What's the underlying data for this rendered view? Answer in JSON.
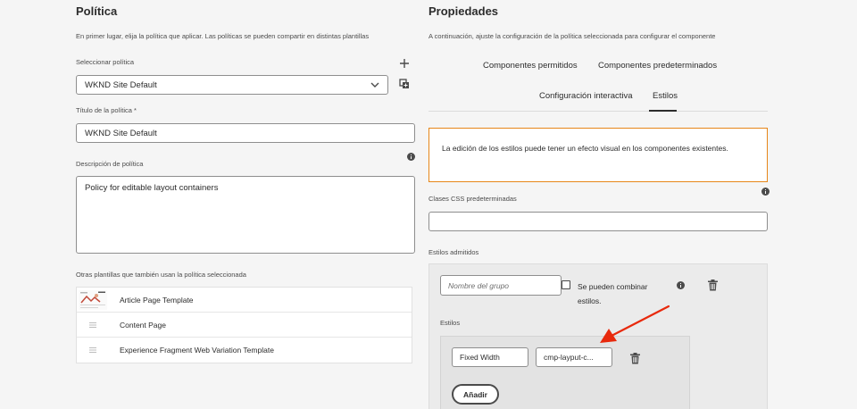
{
  "left": {
    "title": "Política",
    "description": "En primer lugar, elija la política que aplicar. Las políticas se pueden compartir en distintas plantillas",
    "select_label": "Seleccionar política",
    "select_value": "WKND Site Default",
    "policy_title_label": "Título de la política *",
    "policy_title_value": "WKND Site Default",
    "policy_desc_label": "Descripción de política",
    "policy_desc_value": "Policy for editable layout containers",
    "other_templates_label": "Otras plantillas que también usan la política seleccionada",
    "templates": [
      {
        "name": "Article Page Template",
        "thumb": "image"
      },
      {
        "name": "Content Page",
        "thumb": "doc-icon"
      },
      {
        "name": "Experience Fragment Web Variation Template",
        "thumb": "doc-icon"
      }
    ]
  },
  "right": {
    "title": "Propiedades",
    "description": "A continuación, ajuste la configuración de la política seleccionada para configurar el componente",
    "tabs": [
      {
        "label": "Componentes permitidos"
      },
      {
        "label": "Componentes predeterminados"
      },
      {
        "label": "Configuración interactiva"
      },
      {
        "label": "Estilos",
        "selected": true
      }
    ],
    "alert_text": "La edición de los estilos puede tener un efecto visual en los componentes existentes.",
    "css_classes_label": "Clases CSS predeterminadas",
    "css_classes_value": "",
    "allowed_styles_label": "Estilos admitidos",
    "group_name_placeholder": "Nombre del grupo",
    "combine_label": "Se pueden combinar estilos.",
    "styles_label": "Estilos",
    "style_name_value": "Fixed Width",
    "style_class_value": "cmp-layput-c...",
    "add_button": "Añadir"
  },
  "colors": {
    "alert_border": "#e68619",
    "annotation_arrow": "#e8290c"
  }
}
